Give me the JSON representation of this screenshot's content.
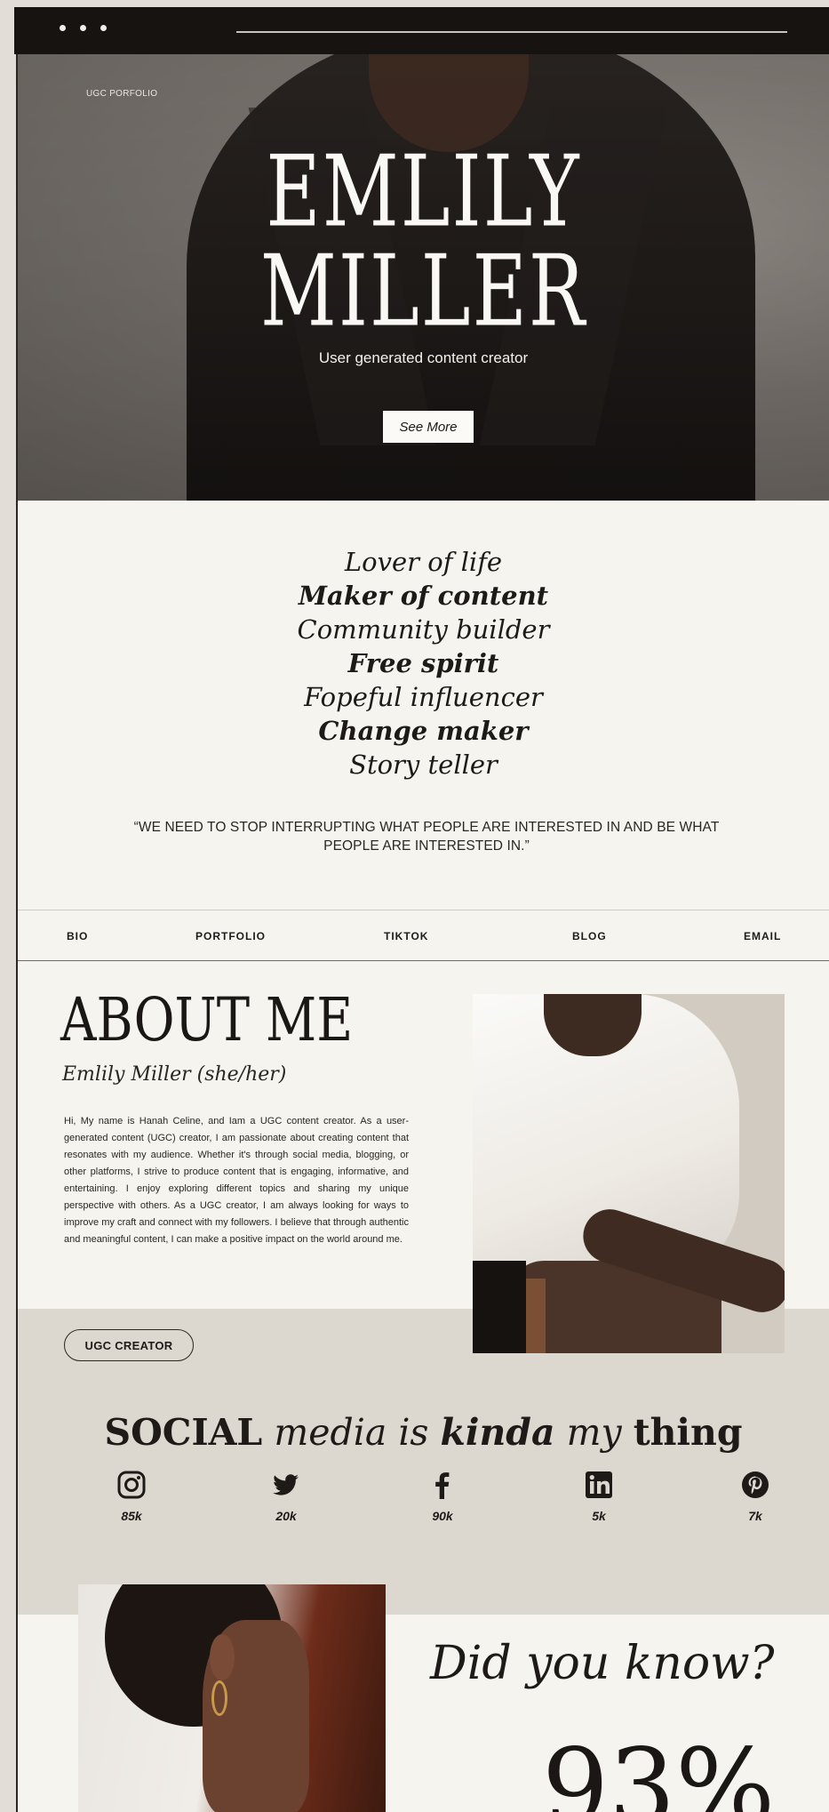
{
  "hero": {
    "tag": "UGC PORFOLIO",
    "first_name": "EMLILY",
    "last_name": "MILLER",
    "subtitle": "User generated content creator",
    "cta_label": "See More"
  },
  "traits": [
    "Lover of life",
    "Maker of content",
    "Community builder",
    "Free spirit",
    "Fopeful influencer",
    "Change maker",
    "Story teller"
  ],
  "quote": "“WE NEED TO STOP INTERRUPTING WHAT PEOPLE ARE INTERESTED IN AND BE WHAT PEOPLE ARE INTERESTED IN.”",
  "nav": {
    "bio": "BIO",
    "portfolio": "PORTFOLIO",
    "tiktok": "TIKTOK",
    "blog": "BLOG",
    "email": "EMAIL"
  },
  "about": {
    "title": "ABOUT ME",
    "name": "Emlily Miller (she/her)",
    "body": "Hi, My name is Hanah Celine, and Iam a UGC content creator. As a user-generated content (UGC) creator, I am passionate about creating content that resonates with my audience. Whether it's through social media, blogging, or other platforms, I strive to produce content that is engaging, informative, and entertaining. I enjoy exploring different topics and sharing my unique perspective with others. As a UGC creator, I am always looking for ways to improve my craft and connect with my followers. I believe that through authentic and meaningful content, I can make a positive impact on the world around me.",
    "badge": "UGC CREATOR"
  },
  "social": {
    "title_1": "SOCIAL",
    "title_2": "media",
    "title_3": "is",
    "title_4": "kinda",
    "title_5": "my",
    "title_6": "thing",
    "instagram": "85k",
    "twitter": "20k",
    "facebook": "90k",
    "linkedin": "5k",
    "pinterest": "7k"
  },
  "did_you_know": {
    "question": "Did you know?",
    "stat": "93%"
  },
  "colors": {
    "background": "#f6f4ef",
    "band": "#dcd7cf",
    "ink": "#1d1a17",
    "chrome": "#161311"
  }
}
